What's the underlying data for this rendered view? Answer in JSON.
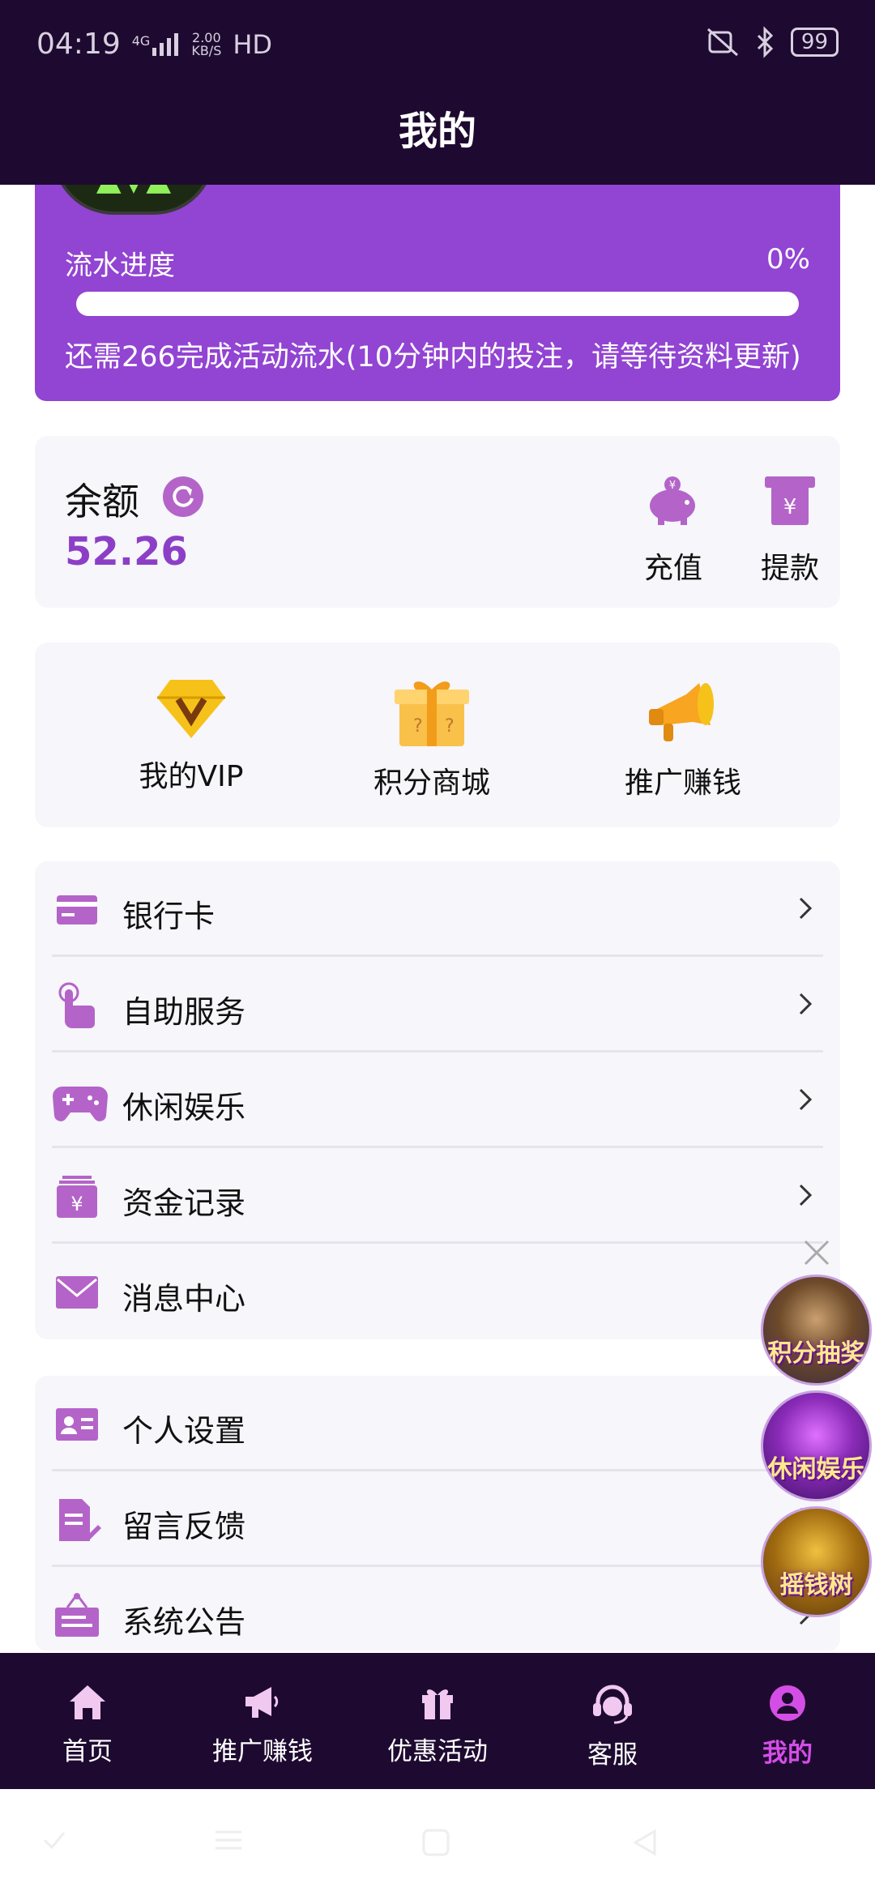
{
  "status_bar": {
    "time": "04:19",
    "network": "4G",
    "speed_value": "2.00",
    "speed_unit": "KB/S",
    "hd": "HD",
    "battery": "99"
  },
  "header": {
    "title": "我的"
  },
  "turnover": {
    "label": "流水进度",
    "percent_text": "0%",
    "progress": 0,
    "note": "还需266完成活动流水(10分钟内的投注，请等待资料更新)"
  },
  "balance": {
    "label": "余额",
    "value": "52.26",
    "actions": [
      {
        "label": "充值",
        "icon": "piggy-bank-icon"
      },
      {
        "label": "提款",
        "icon": "withdraw-icon"
      }
    ]
  },
  "shortcuts": [
    {
      "label": "我的VIP",
      "icon": "vip-diamond-icon"
    },
    {
      "label": "积分商城",
      "icon": "gift-box-icon"
    },
    {
      "label": "推广赚钱",
      "icon": "megaphone-icon"
    }
  ],
  "menu_group_1": [
    {
      "label": "银行卡",
      "icon": "bank-card-icon"
    },
    {
      "label": "自助服务",
      "icon": "tap-hand-icon"
    },
    {
      "label": "休闲娱乐",
      "icon": "gamepad-icon"
    },
    {
      "label": "资金记录",
      "icon": "fund-record-icon"
    },
    {
      "label": "消息中心",
      "icon": "mail-icon"
    }
  ],
  "menu_group_2": [
    {
      "label": "个人设置",
      "icon": "id-card-icon"
    },
    {
      "label": "留言反馈",
      "icon": "feedback-icon"
    },
    {
      "label": "系统公告",
      "icon": "announcement-icon"
    }
  ],
  "floating": [
    {
      "label": "积分抽奖"
    },
    {
      "label": "休闲娱乐"
    },
    {
      "label": "摇钱树"
    }
  ],
  "bottom_nav": [
    {
      "label": "首页",
      "icon": "home-icon"
    },
    {
      "label": "推广赚钱",
      "icon": "megaphone-icon"
    },
    {
      "label": "优惠活动",
      "icon": "gift-icon"
    },
    {
      "label": "客服",
      "icon": "headset-icon"
    },
    {
      "label": "我的",
      "icon": "user-icon",
      "active": true
    }
  ],
  "colors": {
    "header_bg": "#1e0a30",
    "accent": "#9244d2",
    "icon": "#b464c8",
    "active_nav": "#d44ee6"
  }
}
